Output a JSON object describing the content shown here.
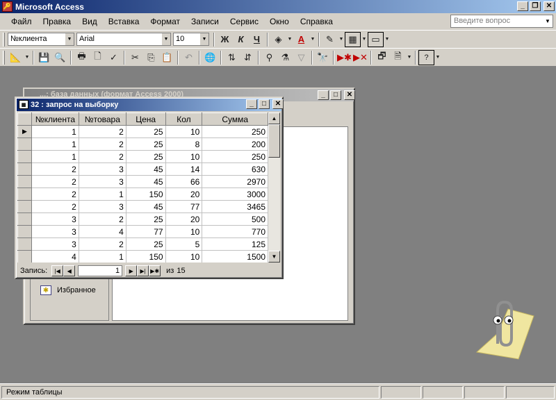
{
  "app": {
    "title": "Microsoft Access"
  },
  "menu": [
    "Файл",
    "Правка",
    "Вид",
    "Вставка",
    "Формат",
    "Записи",
    "Сервис",
    "Окно",
    "Справка"
  ],
  "ask_box": {
    "placeholder": "Введите вопрос"
  },
  "format_toolbar": {
    "field": "№клиента",
    "font": "Arial",
    "size": "10",
    "bold": "Ж",
    "italic": "К",
    "underline": "Ч"
  },
  "db_window": {
    "title": "...: база данных (формат Access 2000)",
    "favorites": "Избранное"
  },
  "query_window": {
    "title": "32 : запрос на выборку",
    "columns": [
      "№клиента",
      "№товара",
      "Цена",
      "Кол",
      "Сумма"
    ],
    "rows": [
      [
        "1",
        "2",
        "25",
        "10",
        "250"
      ],
      [
        "1",
        "2",
        "25",
        "8",
        "200"
      ],
      [
        "1",
        "2",
        "25",
        "10",
        "250"
      ],
      [
        "2",
        "3",
        "45",
        "14",
        "630"
      ],
      [
        "2",
        "3",
        "45",
        "66",
        "2970"
      ],
      [
        "2",
        "1",
        "150",
        "20",
        "3000"
      ],
      [
        "2",
        "3",
        "45",
        "77",
        "3465"
      ],
      [
        "3",
        "2",
        "25",
        "20",
        "500"
      ],
      [
        "3",
        "4",
        "77",
        "10",
        "770"
      ],
      [
        "3",
        "2",
        "25",
        "5",
        "125"
      ],
      [
        "4",
        "1",
        "150",
        "10",
        "1500"
      ]
    ],
    "nav": {
      "label": "Запись:",
      "current": "1",
      "of_label": "из",
      "total": "15"
    }
  },
  "status": {
    "text": "Режим таблицы"
  },
  "colors": {
    "title_active": "#0a246a",
    "title_gradient_end": "#a6caf0",
    "face": "#d4d0c8",
    "mdi_bg": "#808080"
  }
}
